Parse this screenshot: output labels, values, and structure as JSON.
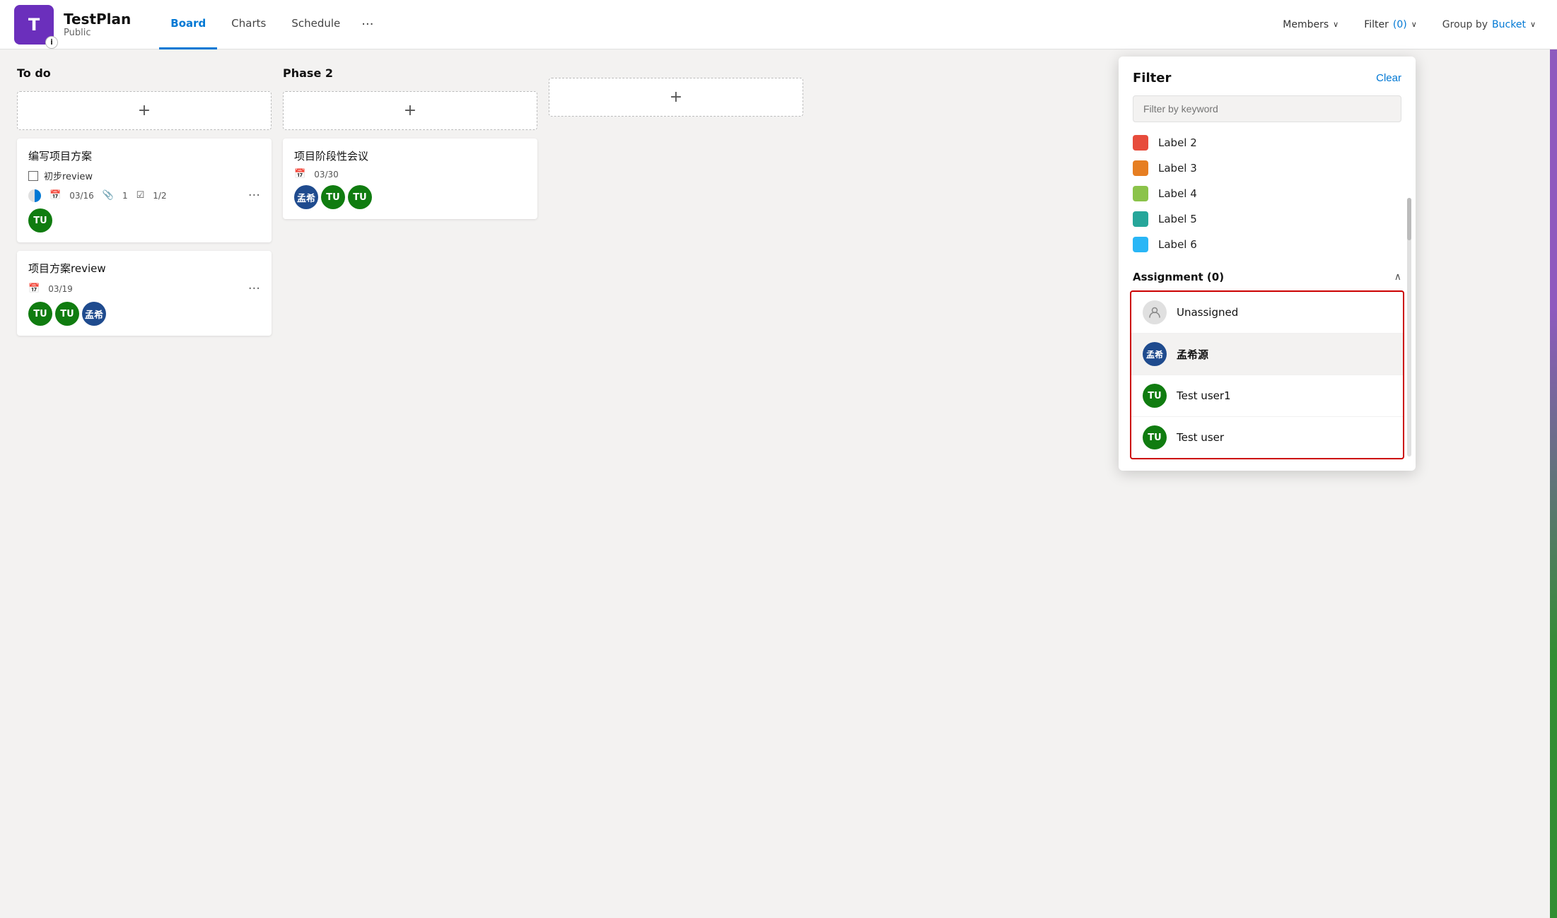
{
  "header": {
    "logo_letter": "T",
    "plan_title": "TestPlan",
    "plan_subtitle": "Public",
    "info_badge": "i"
  },
  "nav": {
    "tabs": [
      {
        "id": "board",
        "label": "Board",
        "active": true
      },
      {
        "id": "charts",
        "label": "Charts",
        "active": false
      },
      {
        "id": "schedule",
        "label": "Schedule",
        "active": false
      }
    ],
    "more_label": "···"
  },
  "topbar_actions": {
    "members_label": "Members",
    "filter_label": "Filter",
    "filter_count": "(0)",
    "groupby_label": "Group by",
    "groupby_value": "Bucket"
  },
  "buckets": [
    {
      "id": "todo",
      "title": "To do",
      "add_label": "+",
      "cards": [
        {
          "id": "card1",
          "title": "编写项目方案",
          "checkbox_label": "初步review",
          "meta_date": "03/16",
          "meta_attach": "1",
          "meta_check": "1/2",
          "avatars": [
            {
              "initials": "TU",
              "color": "green"
            }
          ]
        },
        {
          "id": "card2",
          "title": "项目方案review",
          "meta_date": "03/19",
          "avatars": [
            {
              "initials": "TU",
              "color": "green"
            },
            {
              "initials": "TU",
              "color": "green"
            },
            {
              "initials": "孟希",
              "color": "blue"
            }
          ]
        }
      ]
    },
    {
      "id": "phase2",
      "title": "Phase 2",
      "add_label": "+",
      "cards": [
        {
          "id": "card3",
          "title": "项目阶段性会议",
          "meta_date": "03/30",
          "avatars": [
            {
              "initials": "孟希",
              "color": "blue"
            },
            {
              "initials": "TU",
              "color": "green"
            },
            {
              "initials": "TU",
              "color": "green"
            }
          ]
        }
      ]
    },
    {
      "id": "phase3",
      "title": "",
      "add_label": "+"
    }
  ],
  "filter_panel": {
    "title": "Filter",
    "clear_label": "Clear",
    "search_placeholder": "Filter by keyword",
    "labels": [
      {
        "id": "label2",
        "name": "Label 2",
        "color": "#e74c3c"
      },
      {
        "id": "label3",
        "name": "Label 3",
        "color": "#e67e22"
      },
      {
        "id": "label4",
        "name": "Label 4",
        "color": "#8bc34a"
      },
      {
        "id": "label5",
        "name": "Label 5",
        "color": "#26a69a"
      },
      {
        "id": "label6",
        "name": "Label 6",
        "color": "#29b6f6"
      }
    ],
    "assignment_section": {
      "title": "Assignment (0)",
      "chevron": "∧",
      "items": [
        {
          "id": "unassigned",
          "type": "unassigned",
          "name": "Unassigned",
          "bold": false
        },
        {
          "id": "mengxiyuan",
          "type": "avatar",
          "initials": "孟希",
          "color": "#1f4b8e",
          "name": "孟希源",
          "bold": true
        },
        {
          "id": "testuser1",
          "type": "avatar",
          "initials": "TU",
          "color": "#107c10",
          "name": "Test user1",
          "bold": false
        },
        {
          "id": "testuser",
          "type": "avatar",
          "initials": "TU",
          "color": "#107c10",
          "name": "Test user",
          "bold": false
        }
      ]
    }
  }
}
